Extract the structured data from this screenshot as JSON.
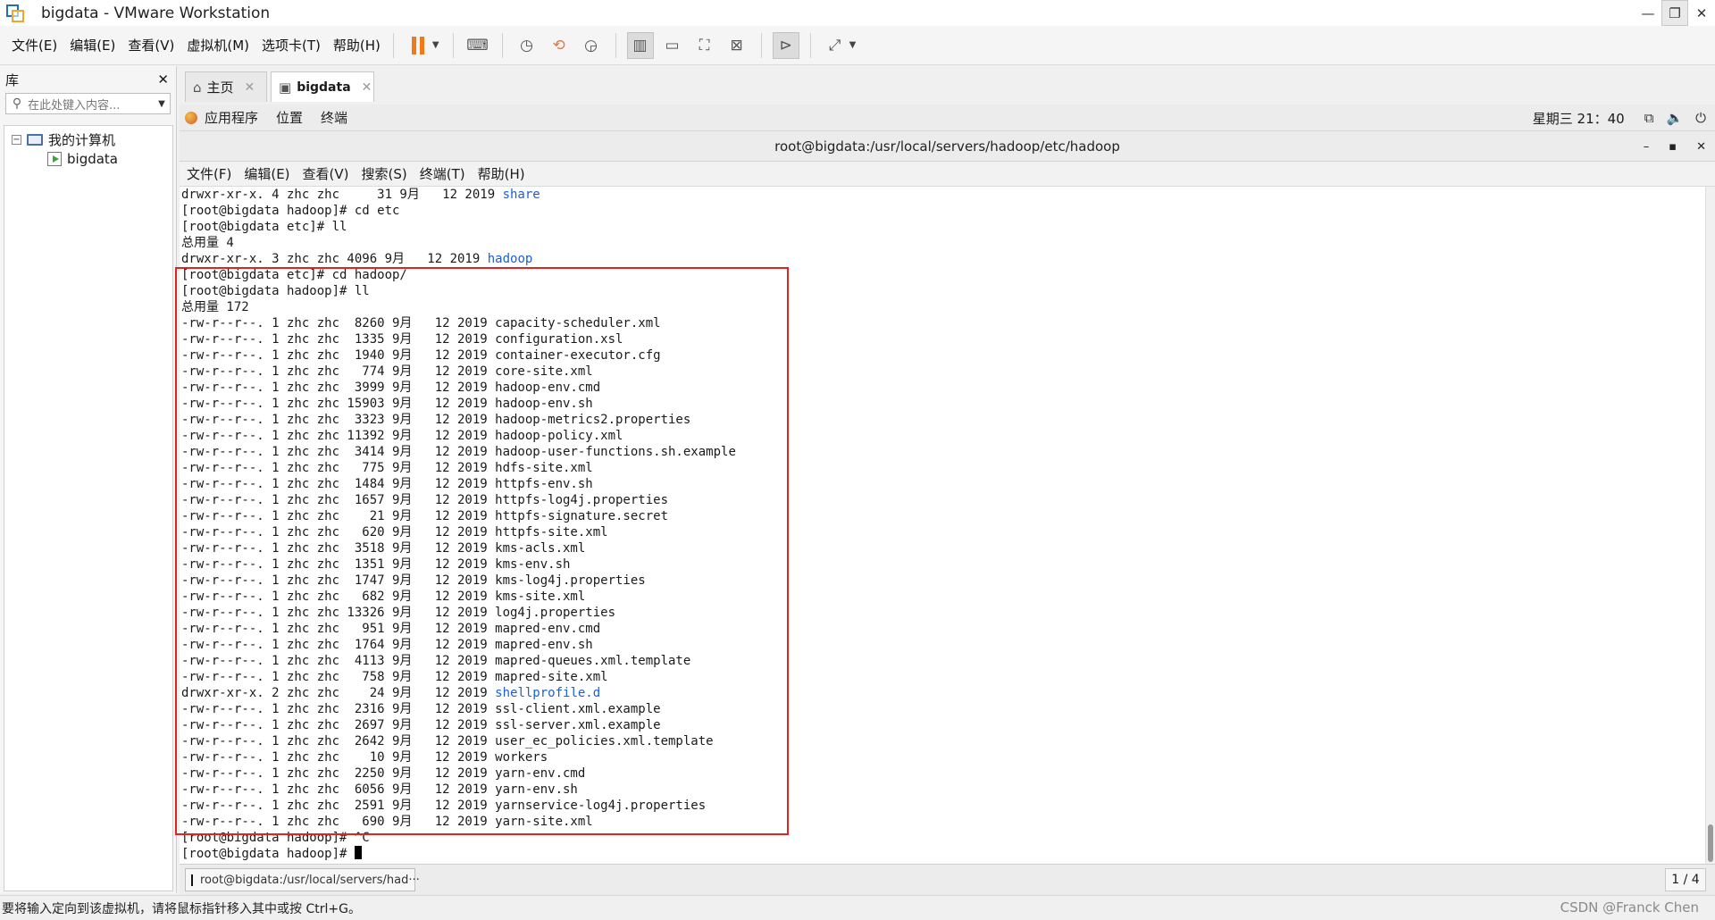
{
  "window": {
    "title": "bigdata - VMware Workstation",
    "minimize": "—",
    "restore": "❐",
    "close": "✕"
  },
  "menu": [
    "文件(E)",
    "编辑(E)",
    "查看(V)",
    "虚拟机(M)",
    "选项卡(T)",
    "帮助(H)"
  ],
  "library": {
    "title": "库",
    "close": "✕",
    "search_placeholder": "在此处键入内容...",
    "tree": {
      "root": "我的计算机",
      "root_toggle": "−",
      "vm": "bigdata"
    }
  },
  "tabs": [
    {
      "label": "主页",
      "icon": "home-icon"
    },
    {
      "label": "bigdata",
      "icon": "vm-icon",
      "active": true
    }
  ],
  "guest_panel": {
    "items": [
      "应用程序",
      "位置",
      "终端"
    ],
    "clock": "星期三 21：40"
  },
  "terminal_window": {
    "title": "root@bigdata:/usr/local/servers/hadoop/etc/hadoop",
    "menu": [
      "文件(F)",
      "编辑(E)",
      "查看(V)",
      "搜索(S)",
      "终端(T)",
      "帮助(H)"
    ],
    "controls": [
      "–",
      "▪",
      "✕"
    ]
  },
  "terminal_lines": [
    {
      "text": "drwxr-xr-x. 4 zhc zhc     31 9月   12 2019 ",
      "dir": "share"
    },
    {
      "text": "[root@bigdata hadoop]# cd etc"
    },
    {
      "text": "[root@bigdata etc]# ll"
    },
    {
      "text": "总用量 4"
    },
    {
      "text": "drwxr-xr-x. 3 zhc zhc 4096 9月   12 2019 ",
      "dir": "hadoop"
    },
    {
      "text": "[root@bigdata etc]# cd hadoop/"
    },
    {
      "text": "[root@bigdata hadoop]# ll"
    },
    {
      "text": "总用量 172"
    },
    {
      "text": "-rw-r--r--. 1 zhc zhc  8260 9月   12 2019 capacity-scheduler.xml"
    },
    {
      "text": "-rw-r--r--. 1 zhc zhc  1335 9月   12 2019 configuration.xsl"
    },
    {
      "text": "-rw-r--r--. 1 zhc zhc  1940 9月   12 2019 container-executor.cfg"
    },
    {
      "text": "-rw-r--r--. 1 zhc zhc   774 9月   12 2019 core-site.xml"
    },
    {
      "text": "-rw-r--r--. 1 zhc zhc  3999 9月   12 2019 hadoop-env.cmd"
    },
    {
      "text": "-rw-r--r--. 1 zhc zhc 15903 9月   12 2019 hadoop-env.sh"
    },
    {
      "text": "-rw-r--r--. 1 zhc zhc  3323 9月   12 2019 hadoop-metrics2.properties"
    },
    {
      "text": "-rw-r--r--. 1 zhc zhc 11392 9月   12 2019 hadoop-policy.xml"
    },
    {
      "text": "-rw-r--r--. 1 zhc zhc  3414 9月   12 2019 hadoop-user-functions.sh.example"
    },
    {
      "text": "-rw-r--r--. 1 zhc zhc   775 9月   12 2019 hdfs-site.xml"
    },
    {
      "text": "-rw-r--r--. 1 zhc zhc  1484 9月   12 2019 httpfs-env.sh"
    },
    {
      "text": "-rw-r--r--. 1 zhc zhc  1657 9月   12 2019 httpfs-log4j.properties"
    },
    {
      "text": "-rw-r--r--. 1 zhc zhc    21 9月   12 2019 httpfs-signature.secret"
    },
    {
      "text": "-rw-r--r--. 1 zhc zhc   620 9月   12 2019 httpfs-site.xml"
    },
    {
      "text": "-rw-r--r--. 1 zhc zhc  3518 9月   12 2019 kms-acls.xml"
    },
    {
      "text": "-rw-r--r--. 1 zhc zhc  1351 9月   12 2019 kms-env.sh"
    },
    {
      "text": "-rw-r--r--. 1 zhc zhc  1747 9月   12 2019 kms-log4j.properties"
    },
    {
      "text": "-rw-r--r--. 1 zhc zhc   682 9月   12 2019 kms-site.xml"
    },
    {
      "text": "-rw-r--r--. 1 zhc zhc 13326 9月   12 2019 log4j.properties"
    },
    {
      "text": "-rw-r--r--. 1 zhc zhc   951 9月   12 2019 mapred-env.cmd"
    },
    {
      "text": "-rw-r--r--. 1 zhc zhc  1764 9月   12 2019 mapred-env.sh"
    },
    {
      "text": "-rw-r--r--. 1 zhc zhc  4113 9月   12 2019 mapred-queues.xml.template"
    },
    {
      "text": "-rw-r--r--. 1 zhc zhc   758 9月   12 2019 mapred-site.xml"
    },
    {
      "text": "drwxr-xr-x. 2 zhc zhc    24 9月   12 2019 ",
      "dir": "shellprofile.d"
    },
    {
      "text": "-rw-r--r--. 1 zhc zhc  2316 9月   12 2019 ssl-client.xml.example"
    },
    {
      "text": "-rw-r--r--. 1 zhc zhc  2697 9月   12 2019 ssl-server.xml.example"
    },
    {
      "text": "-rw-r--r--. 1 zhc zhc  2642 9月   12 2019 user_ec_policies.xml.template"
    },
    {
      "text": "-rw-r--r--. 1 zhc zhc    10 9月   12 2019 workers"
    },
    {
      "text": "-rw-r--r--. 1 zhc zhc  2250 9月   12 2019 yarn-env.cmd"
    },
    {
      "text": "-rw-r--r--. 1 zhc zhc  6056 9月   12 2019 yarn-env.sh"
    },
    {
      "text": "-rw-r--r--. 1 zhc zhc  2591 9月   12 2019 yarnservice-log4j.properties"
    },
    {
      "text": "-rw-r--r--. 1 zhc zhc   690 9月   12 2019 yarn-site.xml"
    },
    {
      "text": "[root@bigdata hadoop]# ^C"
    },
    {
      "text": "[root@bigdata hadoop]# ",
      "cursor": true
    }
  ],
  "guest_taskbar": {
    "task": "root@bigdata:/usr/local/servers/had···",
    "workspace": "1 / 4"
  },
  "statusbar": {
    "text": "要将输入定向到该虚拟机，请将鼠标指针移入其中或按 Ctrl+G。",
    "watermark": "CSDN @Franck Chen"
  },
  "colors": {
    "highlight": "#e02424",
    "dir": "#1b5fd8"
  }
}
